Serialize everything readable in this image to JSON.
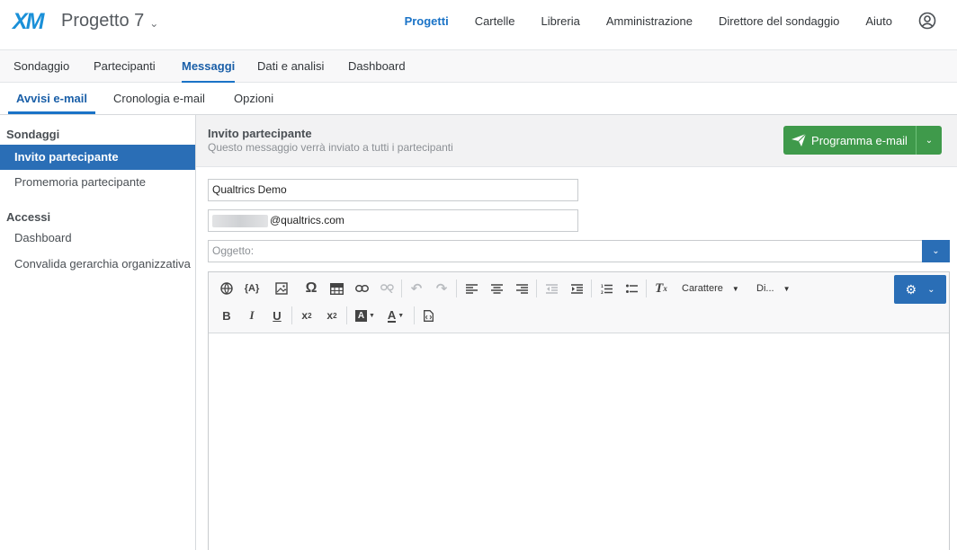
{
  "header": {
    "logo": "XM",
    "project_title": "Progetto 7",
    "nav": [
      "Progetti",
      "Cartelle",
      "Libreria",
      "Amministrazione",
      "Direttore del sondaggio",
      "Aiuto"
    ]
  },
  "subnav": {
    "tabs": [
      "Sondaggio",
      "Partecipanti",
      "Messaggi",
      "Dati e analisi",
      "Dashboard"
    ]
  },
  "subnav2": {
    "tabs": [
      "Avvisi e-mail",
      "Cronologia e-mail",
      "Opzioni"
    ]
  },
  "sidebar": {
    "section1": "Sondaggi",
    "items1": [
      "Invito partecipante",
      "Promemoria partecipante"
    ],
    "section2": "Accessi",
    "items2": [
      "Dashboard",
      "Convalida gerarchia organizzativa"
    ]
  },
  "message": {
    "title": "Invito partecipante",
    "subtitle": "Questo messaggio verrà inviato a tutti i partecipanti",
    "schedule_label": "Programma e-mail",
    "from_name": "Qualtrics Demo",
    "from_email_suffix": "@qualtrics.com",
    "subject_placeholder": "Oggetto:"
  },
  "editor": {
    "font_select": "Carattere",
    "size_select": "Di..."
  },
  "colors": {
    "accent": "#1a73c7",
    "primary_btn": "#3f9a4b",
    "sidebar_active": "#2a6eb6"
  }
}
